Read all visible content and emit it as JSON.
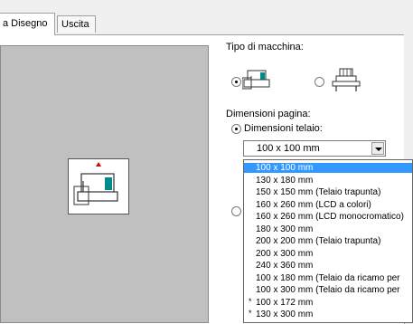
{
  "tabs": [
    {
      "label": "a Disegno"
    },
    {
      "label": "Uscita"
    }
  ],
  "machine_type": {
    "heading": "Tipo di macchina:",
    "options": [
      {
        "icon": "sewing-machine-icon",
        "selected": true
      },
      {
        "icon": "multi-needle-machine-icon",
        "selected": false
      }
    ]
  },
  "page_size": {
    "heading": "Dimensioni pagina:",
    "hoop_option_label": "Dimensioni telaio:",
    "hoop_selected": true,
    "combo_value": "100 x 100 mm",
    "dropdown_items": [
      {
        "label": "100 x 100 mm",
        "selected": true,
        "star": ""
      },
      {
        "label": "130 x 180 mm",
        "selected": false,
        "star": ""
      },
      {
        "label": "150 x 150 mm (Telaio trapunta)",
        "selected": false,
        "star": ""
      },
      {
        "label": "160 x 260 mm (LCD a colori)",
        "selected": false,
        "star": ""
      },
      {
        "label": "160 x 260 mm (LCD monocromatico)",
        "selected": false,
        "star": ""
      },
      {
        "label": "180 x 300 mm",
        "selected": false,
        "star": ""
      },
      {
        "label": "200 x 200 mm (Telaio trapunta)",
        "selected": false,
        "star": ""
      },
      {
        "label": "200 x 300 mm",
        "selected": false,
        "star": ""
      },
      {
        "label": "240 x 360 mm",
        "selected": false,
        "star": ""
      },
      {
        "label": "100 x 180 mm (Telaio da ricamo per",
        "selected": false,
        "star": ""
      },
      {
        "label": "100 x 300 mm (Telaio da ricamo per",
        "selected": false,
        "star": ""
      },
      {
        "label": "100 x 172 mm",
        "selected": false,
        "star": "*"
      },
      {
        "label": "130 x 300 mm",
        "selected": false,
        "star": "*"
      }
    ]
  },
  "colors": {
    "selection": "#3399ff",
    "preview_bg": "#c0c0c0",
    "accent_red": "#e00000",
    "machine_teal": "#008b8b"
  }
}
